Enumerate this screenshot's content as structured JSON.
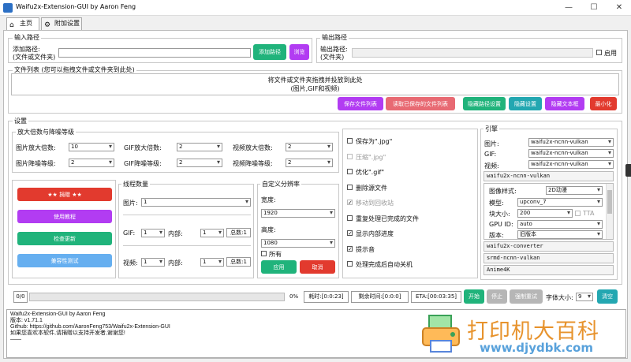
{
  "window": {
    "title": "Waifu2x-Extension-GUI by Aaron Feng",
    "minimize": "—",
    "maximize": "☐",
    "close": "✕"
  },
  "tabs": [
    {
      "label": "主页"
    },
    {
      "label": "附加设置"
    }
  ],
  "input_path": {
    "group": "输入路径",
    "label_line1": "添加路径:",
    "label_line2": "(文件或文件夹)",
    "value": "",
    "add_button": "添加路径",
    "browse_button": "浏览"
  },
  "output_path": {
    "group": "输出路径",
    "label_line1": "输出路径:",
    "label_line2": "(文件夹)",
    "value": "",
    "enable_label": "启用"
  },
  "file_list": {
    "group": "文件列表 (您可以拖拽文件或文件夹到此处)",
    "drop_line1": "将文件或文件夹拖拽并投放到此处",
    "drop_line2": "(图片,GIF和视频)",
    "buttons": [
      "保存文件列表",
      "读取已保存的文件列表",
      "隐藏路径设置",
      "隐藏设置",
      "隐藏文本框",
      "最小化"
    ]
  },
  "settings": {
    "group": "设置",
    "scale": {
      "group": "放大倍数与降噪等级",
      "img_scale_label": "图片放大倍数:",
      "img_scale": "10",
      "gif_scale_label": "GIF放大倍数:",
      "gif_scale": "2",
      "video_scale_label": "视频放大倍数:",
      "video_scale": "2",
      "img_noise_label": "图片降噪等级:",
      "img_noise": "2",
      "gif_noise_label": "GIF降噪等级:",
      "gif_noise": "2",
      "video_noise_label": "视频降噪等级:",
      "video_noise": "2"
    },
    "left_buttons": [
      "★★ 捐赠 ★★",
      "使用教程",
      "检查更新",
      "兼容性测试"
    ],
    "threads": {
      "group": "线程数量",
      "img_label": "图片:",
      "img_value": "1",
      "gif_label": "GIF:",
      "gif_value": "1",
      "gif_inner_label": "内部:",
      "gif_inner": "1",
      "total1": "总数:1",
      "video_label": "视频:",
      "video_value": "1",
      "video_inner_label": "内部:",
      "video_inner": "1",
      "total2": "总数:1"
    },
    "resolution": {
      "group": "自定义分辨率",
      "width_label": "宽度:",
      "width": "1920",
      "height_label": "高度:",
      "height": "1080",
      "all_label": "所有",
      "apply": "应用",
      "cancel": "取消"
    },
    "options": [
      {
        "label": "保存为\".jpg\"",
        "checked": false,
        "disabled": false
      },
      {
        "label": "压缩\".jpg\"",
        "checked": false,
        "disabled": true
      },
      {
        "label": "优化\".gif\"",
        "checked": false,
        "disabled": false
      },
      {
        "label": "删除源文件",
        "checked": false,
        "disabled": false
      },
      {
        "label": "移动到回收站",
        "checked": true,
        "disabled": true
      },
      {
        "label": "重复处理已完成的文件",
        "checked": false,
        "disabled": false
      },
      {
        "label": "显示内部进度",
        "checked": true,
        "disabled": false
      },
      {
        "label": "提示音",
        "checked": true,
        "disabled": false
      },
      {
        "label": "处理完成后自动关机",
        "checked": false,
        "disabled": false
      }
    ],
    "engine": {
      "group": "引擎",
      "img_label": "图片:",
      "img_value": "waifu2x-ncnn-vulkan",
      "gif_label": "GIF:",
      "gif_value": "waifu2x-ncnn-vulkan",
      "video_label": "视频:",
      "video_value": "waifu2x-ncnn-vulkan",
      "sections": [
        "waifu2x-ncnn-vulkan",
        "waifu2x-converter",
        "srmd-ncnn-vulkan",
        "Anime4K"
      ],
      "style_label": "图像样式:",
      "style_value": "2D动漫",
      "model_label": "模型:",
      "model_value": "upconv_7",
      "tile_label": "块大小:",
      "tile_value": "200",
      "tta_label": "TTA",
      "gpu_label": "GPU ID:",
      "gpu_value": "auto",
      "version_label": "版本:",
      "version_value": "旧版本"
    }
  },
  "bottom": {
    "count": "0/0",
    "percent": "0%",
    "elapsed": "耗时:[0:0:23]",
    "remaining": "剩余时间:[0:0:0]",
    "eta": "ETA:[00:03:35]",
    "start": "开始",
    "pause": "停止",
    "force_retry": "强制重试",
    "font_label": "字体大小:",
    "font_size": "9",
    "clear": "清空"
  },
  "log": {
    "lines": [
      "Waifu2x-Extension-GUI by Aaron Feng",
      "版本: v1.71.1",
      "Github: https://github.com/AaronFeng753/Waifu2x-Extension-GUI",
      "如果您喜欢本软件,请捐赠以支持开发者,谢谢您!",
      "——"
    ]
  },
  "watermark": {
    "text": "打印机大百科",
    "url": "www.djydbk.com"
  }
}
